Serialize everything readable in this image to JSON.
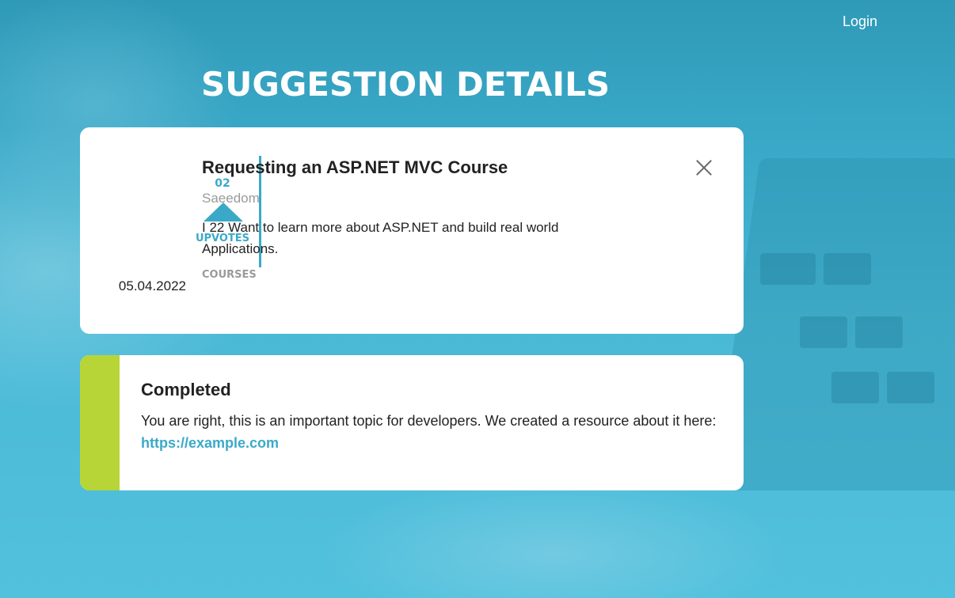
{
  "header": {
    "login_label": "Login"
  },
  "page_title": "SUGGESTION DETAILS",
  "suggestion": {
    "upvote_count": "02",
    "upvotes_label": "UPVOTES",
    "date": "05.04.2022",
    "title": "Requesting an ASP.NET MVC Course",
    "author": "Saeedom",
    "description": "I 22 Want to learn more about ASP.NET and build real world Applications.",
    "category": "COURSES"
  },
  "status": {
    "title": "Completed",
    "message": "You are right, this is an important topic for developers. We created a resource about it here:",
    "link_text": "https://example.com",
    "color": "#b7d536"
  },
  "colors": {
    "accent": "#3aa9c8",
    "background": "#44b3d1"
  },
  "icons": {
    "close": "close-icon",
    "upvote": "upvote-arrow-icon"
  }
}
